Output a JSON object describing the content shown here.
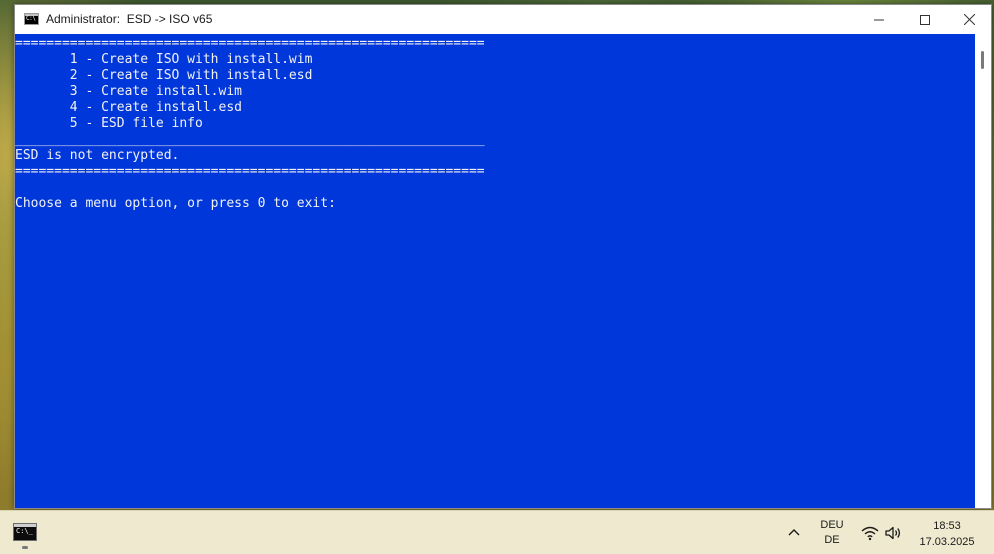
{
  "window": {
    "title": "Administrator:  ESD -> ISO v65",
    "icon": "cmd-icon",
    "controls": [
      "minimize-icon",
      "maximize-icon",
      "close-icon"
    ]
  },
  "console": {
    "colors": {
      "background": "#0037da",
      "foreground": "#f2f2f2"
    },
    "lines": [
      "============================================================",
      "       1 - Create ISO with install.wim",
      "       2 - Create ISO with install.esd",
      "       3 - Create install.wim",
      "       4 - Create install.esd",
      "       5 - ESD file info",
      "____________________________________________________________",
      "ESD is not encrypted.",
      "============================================================",
      "",
      "Choose a menu option, or press 0 to exit: "
    ]
  },
  "taskbar": {
    "app_icon": "cmd-icon",
    "tray": {
      "chevron": "chevron-up-icon",
      "language_line1": "DEU",
      "language_line2": "DE",
      "wifi": "wifi-icon",
      "volume": "speaker-icon"
    },
    "clock": {
      "time": "18:53",
      "date": "17.03.2025"
    }
  }
}
